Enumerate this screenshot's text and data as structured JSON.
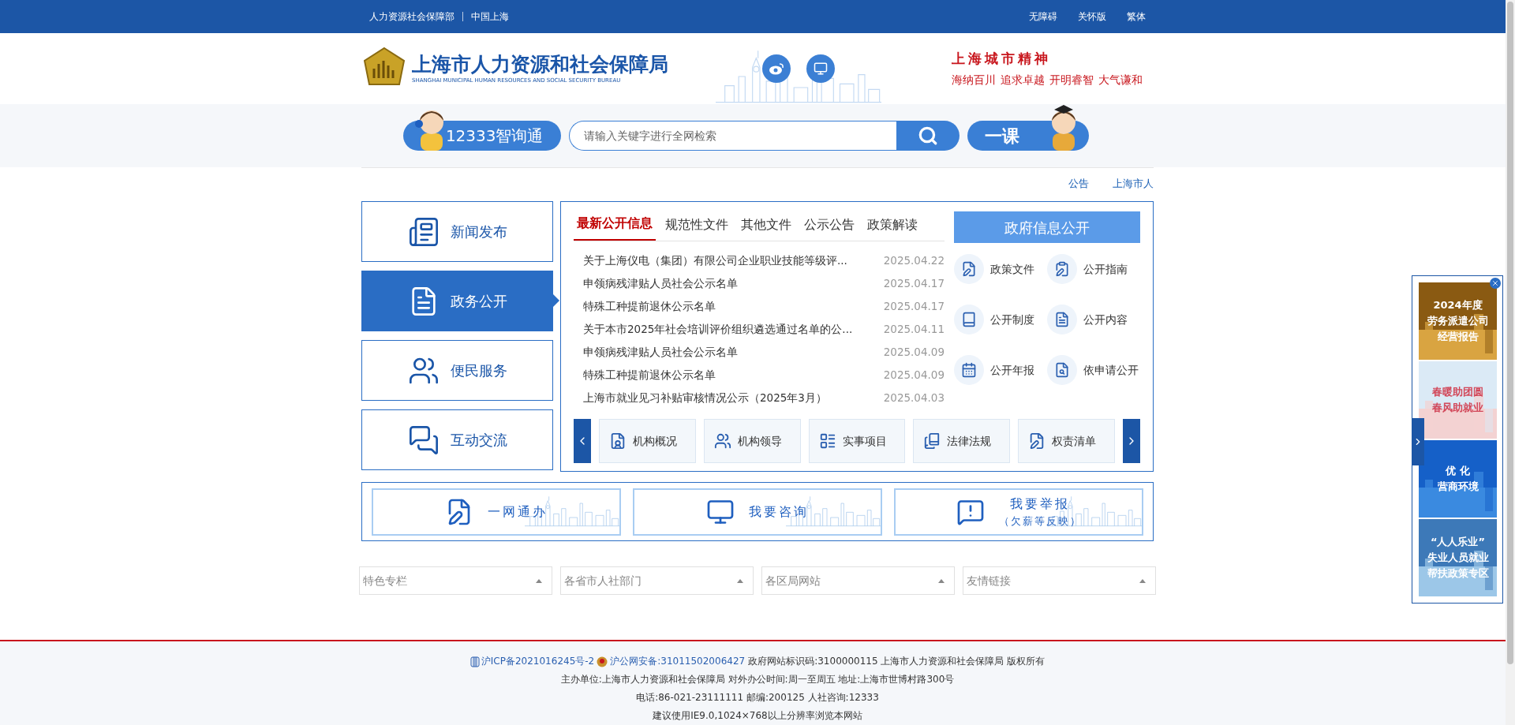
{
  "top_bar": {
    "left_links": [
      "人力资源社会保障部",
      "中国上海"
    ],
    "right_links": [
      "无障碍",
      "关怀版",
      "繁体"
    ]
  },
  "header": {
    "title": "上海市人力资源和社会保障局",
    "subtitle": "SHANGHAI MUNICIPAL HUMAN RESOURCES AND SOCIAL SECURITY BUREAU",
    "motto_title": "上海城市精神",
    "motto_items": [
      "海纳百川",
      "追求卓越",
      "开明睿智",
      "大气谦和"
    ]
  },
  "search": {
    "assistant_label": "12333智询通",
    "placeholder": "请输入关键字进行全网检索",
    "course_label": "一课"
  },
  "notice_links": [
    "公告",
    "上海市人"
  ],
  "side_nav": [
    {
      "label": "新闻发布",
      "selected": false
    },
    {
      "label": "政务公开",
      "selected": true
    },
    {
      "label": "便民服务",
      "selected": false
    },
    {
      "label": "互动交流",
      "selected": false
    }
  ],
  "tabs": [
    {
      "label": "最新公开信息",
      "selected": true
    },
    {
      "label": "规范性文件",
      "selected": false
    },
    {
      "label": "其他文件",
      "selected": false
    },
    {
      "label": "公示公告",
      "selected": false
    },
    {
      "label": "政策解读",
      "selected": false
    }
  ],
  "news": [
    {
      "title": "关于上海仪电（集团）有限公司企业职业技能等级评...",
      "date": "2025.04.22"
    },
    {
      "title": "申领病残津贴人员社会公示名单",
      "date": "2025.04.17"
    },
    {
      "title": "特殊工种提前退休公示名单",
      "date": "2025.04.17"
    },
    {
      "title": "关于本市2025年社会培训评价组织遴选通过名单的公...",
      "date": "2025.04.11"
    },
    {
      "title": "申领病残津贴人员社会公示名单",
      "date": "2025.04.09"
    },
    {
      "title": "特殊工种提前退休公示名单",
      "date": "2025.04.09"
    },
    {
      "title": "上海市就业见习补贴审核情况公示（2025年3月）",
      "date": "2025.04.03"
    }
  ],
  "info_button": "政府信息公开",
  "info_links": [
    "政策文件",
    "公开指南",
    "公开制度",
    "公开内容",
    "公开年报",
    "依申请公开"
  ],
  "carousel": [
    "机构概况",
    "机构领导",
    "实事项目",
    "法律法规",
    "权责清单"
  ],
  "services": [
    {
      "label": "一网通办"
    },
    {
      "label": "我要咨询"
    },
    {
      "label": "我要举报",
      "note": "（欠薪等反映）"
    }
  ],
  "dropdowns": [
    {
      "placeholder": "特色专栏"
    },
    {
      "placeholder": "各省市人社部门"
    },
    {
      "placeholder": "各区局网站"
    },
    {
      "placeholder": "友情链接"
    }
  ],
  "banners": [
    {
      "lines": [
        "2024年度",
        "劳务派遣公司",
        "经营报告"
      ]
    },
    {
      "lines": [
        "春暖助团圆",
        "春风助就业"
      ]
    },
    {
      "lines": [
        "优 化",
        "营商环境"
      ]
    },
    {
      "lines": [
        "“人人乐业”",
        "失业人员就业",
        "帮扶政策专区"
      ]
    }
  ],
  "footer": {
    "icp": "沪ICP备2021016245号-2",
    "police": "沪公网安备:31011502006427",
    "copyright": "政府网站标识码:3100000115 上海市人力资源和社会保障局 版权所有",
    "lines": [
      "主办单位:上海市人力资源和社会保障局 对外办公时间:周一至周五 地址:上海市世博村路300号",
      "电话:86-021-23111111 邮编:200125 人社咨询:12333",
      "建议使用IE9.0,1024×768以上分辨率浏览本网站"
    ]
  }
}
